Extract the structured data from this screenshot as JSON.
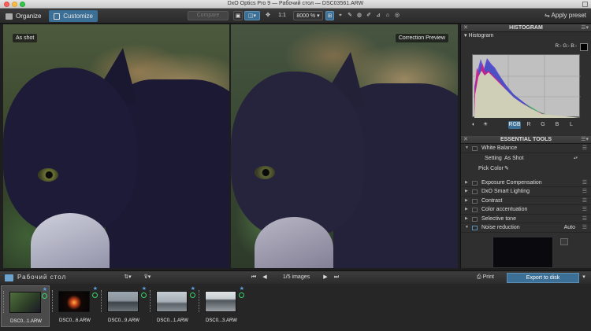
{
  "window": {
    "title": "DxO Optics Pro 9 — Рабочий стол — DSC03561.ARW"
  },
  "toolbar": {
    "tab_organize": "Organize",
    "tab_customize": "Customize",
    "compare": "Compare",
    "zoom_fit": "1:1",
    "zoom_level": "8000 %",
    "apply_preset": "Apply preset"
  },
  "viewer": {
    "left_label": "As shot",
    "right_label": "Correction Preview"
  },
  "histogram_panel": {
    "title": "HISTOGRAM",
    "subtitle": "Histogram",
    "readout": "R:- G:- B:-",
    "channels": [
      "RGB",
      "R",
      "G",
      "B",
      "L"
    ],
    "selected_channel": "RGB"
  },
  "tools_panel": {
    "title": "ESSENTIAL TOOLS",
    "white_balance": {
      "label": "White Balance",
      "setting_label": "Setting",
      "setting_value": "As Shot",
      "pick_color_label": "Pick Color"
    },
    "tools": [
      "Exposure Compensation",
      "DxO Smart Lighting",
      "Contrast",
      "Color accentuation",
      "Selective tone"
    ],
    "noise_reduction": {
      "label": "Noise reduction",
      "mode": "Auto"
    }
  },
  "browser": {
    "folder_name": "Рабочий стол",
    "pager": "1/5 images",
    "print": "Print",
    "export": "Export to disk",
    "thumbnails": [
      {
        "name": "DSC0...1.ARW"
      },
      {
        "name": "DSC0...6.ARW"
      },
      {
        "name": "DSC0...9.ARW"
      },
      {
        "name": "DSC0...1.ARW"
      },
      {
        "name": "DSC0...3.ARW"
      }
    ]
  },
  "colors": {
    "accent": "#3b6f95",
    "panel": "#2f2f2f",
    "ok_badge": "#3bd36a",
    "star": "#5aa0e0"
  }
}
